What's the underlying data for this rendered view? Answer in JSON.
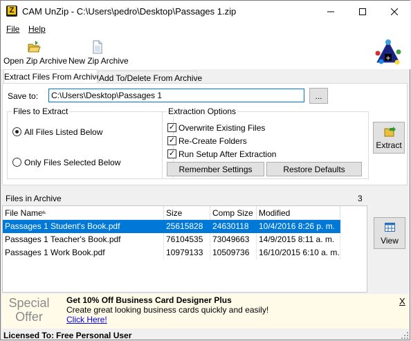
{
  "window": {
    "title": "CAM UnZip - C:\\Users\\pedro\\Desktop\\Passages 1.zip",
    "app_icon_letter": "Z",
    "controls": [
      "minimize-icon",
      "maximize-icon",
      "close-icon"
    ]
  },
  "menu": {
    "file": "File",
    "help": "Help"
  },
  "toolbar": {
    "open_zip": "Open Zip Archive",
    "new_zip": "New Zip Archive"
  },
  "tabs": {
    "extract": "Extract Files From Archive",
    "add_delete": "Add To/Delete From Archive"
  },
  "extract": {
    "save_to_label": "Save to:",
    "save_to_value": "C:\\Users\\Desktop\\Passages 1",
    "browse_label": "...",
    "files_to_extract_title": "Files to Extract",
    "all_files": "All Files Listed Below",
    "selected_files": "Only Files Selected Below",
    "extraction_options_title": "Extraction Options",
    "overwrite": "Overwrite Existing Files",
    "recreate": "Re-Create Folders",
    "run_setup": "Run Setup After Extraction",
    "remember": "Remember Settings",
    "restore": "Restore Defaults",
    "extract_button": "Extract"
  },
  "files": {
    "header": "Files in Archive",
    "count": "3",
    "columns": [
      "File Name",
      "Size",
      "Comp Size",
      "Modified"
    ],
    "rows": [
      {
        "name": "Passages 1 Student's Book.pdf",
        "size": "25615828",
        "comp": "24630118",
        "modified": "10/4/2016 8:26 p. m."
      },
      {
        "name": "Passages 1 Teacher's Book.pdf",
        "size": "76104535",
        "comp": "73049663",
        "modified": "14/9/2015 8:11 a. m."
      },
      {
        "name": "Passages 1 Work Book.pdf",
        "size": "10979133",
        "comp": "10509736",
        "modified": "16/10/2015 6:10 a. m."
      }
    ],
    "view_button": "View"
  },
  "offer": {
    "special_line1": "Special",
    "special_line2": "Offer",
    "headline": "Get 10% Off Business Card Designer Plus",
    "body": "Create great looking business cards quickly and easily!",
    "link": "Click Here!",
    "close": "X"
  },
  "status": {
    "label": "Licensed To:",
    "value": "Free Personal User"
  },
  "colors": {
    "selection": "#0078d7",
    "offer_bg": "#fffbe8",
    "offer_text": "#8a8a8a",
    "link": "#0000ee"
  }
}
